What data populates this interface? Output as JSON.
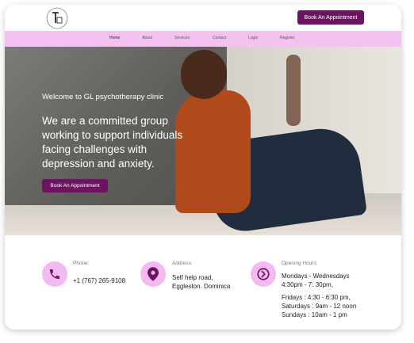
{
  "header": {
    "book_button": "Book An Appointment"
  },
  "nav": {
    "items": [
      {
        "label": "Home"
      },
      {
        "label": "About"
      },
      {
        "label": "Services"
      },
      {
        "label": "Contact"
      },
      {
        "label": "Login"
      },
      {
        "label": "Register"
      }
    ]
  },
  "hero": {
    "welcome": "Welcome to GL psychotherapy clinic",
    "mission": "We are a committed group working to support individuals facing challenges with depression and anxiety.",
    "book_button": "Book An Appointment"
  },
  "info": {
    "phone": {
      "label": "Phone:",
      "value": "+1 (767) 265-9108",
      "icon": "phone-icon"
    },
    "address": {
      "label": "Address:",
      "line1": "Self help road,",
      "line2": "Eggleston. Dominica",
      "icon": "location-pin-icon"
    },
    "hours": {
      "label": "Opening Hours:",
      "line1": "Mondays - Wednesdays",
      "line2": "4:30pm - 7: 30pm,",
      "line3": "Fridays : 4:30 - 6:30 pm,",
      "line4": "Saturdays : 9am - 12 noon",
      "line5": "Sundays : 10am - 1 pm",
      "icon": "chevron-right-circle-icon"
    }
  },
  "colors": {
    "accent": "#6b1460",
    "nav_bg": "#f4c2f1",
    "icon_bg": "#f4b9f0",
    "icon_fg": "#6b1460"
  }
}
